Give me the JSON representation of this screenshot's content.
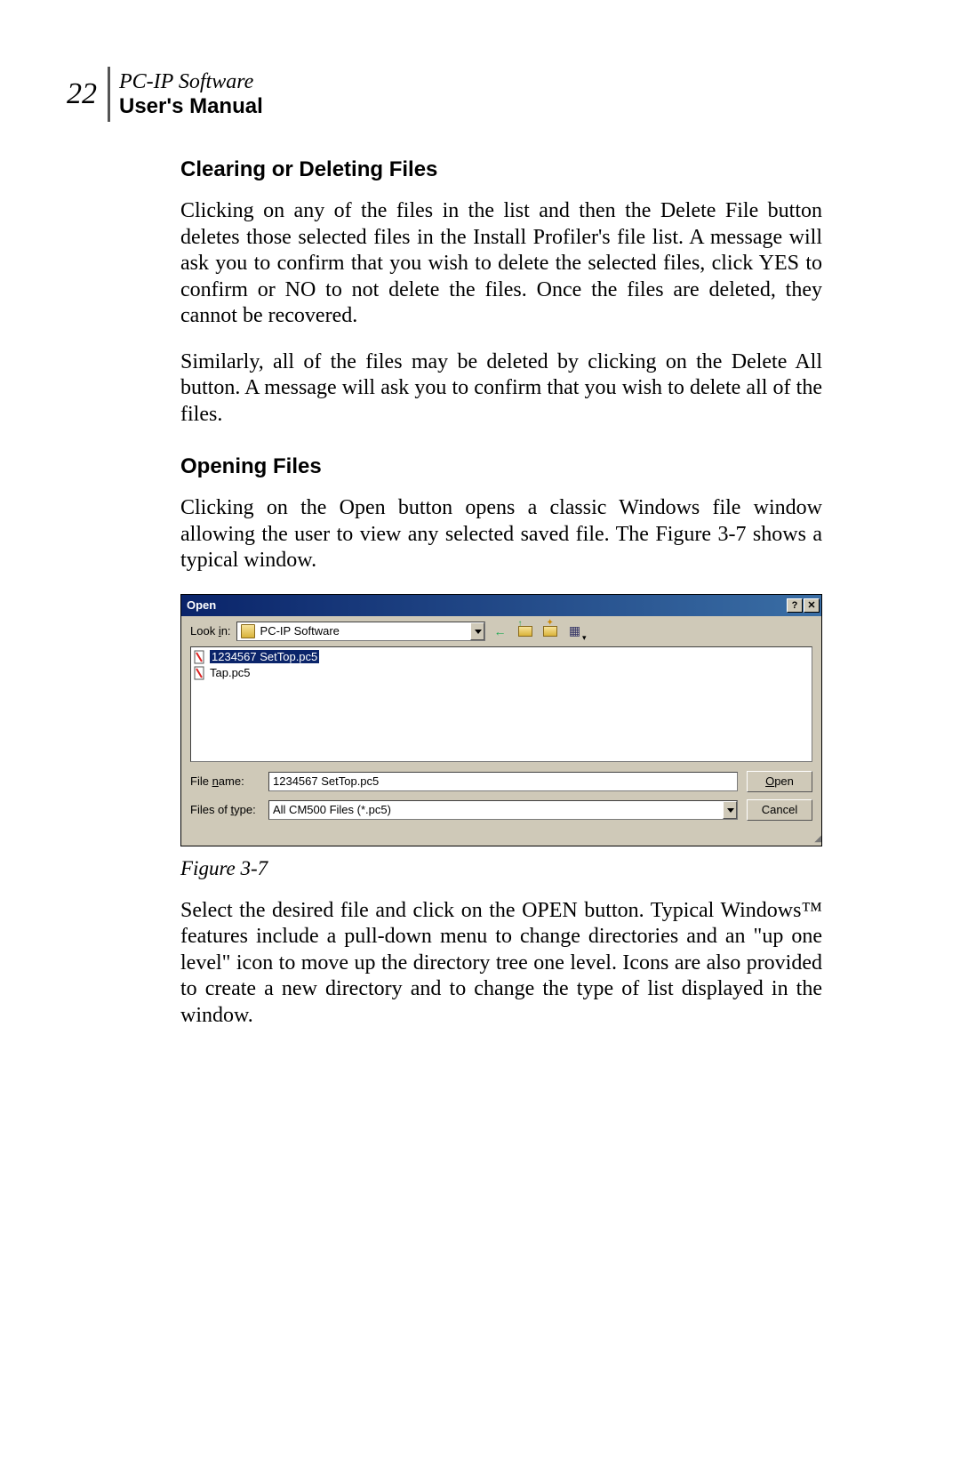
{
  "header": {
    "page_number": "22",
    "title_italic": "PC-IP Software",
    "title_bold": "User's Manual"
  },
  "section1": {
    "heading": "Clearing or Deleting Files",
    "p1": "Clicking on any of the files in the list and then the Delete File button deletes those selected files in the Install Profiler's file list. A message will ask you to confirm that you wish to delete the selected files, click YES to confirm or NO to not delete the files. Once the files are deleted, they cannot be recovered.",
    "p2": "Similarly, all of the files may be deleted by clicking on the Delete All button. A message will ask you to confirm that you wish to delete all of the files."
  },
  "section2": {
    "heading": "Opening Files",
    "p1": "Clicking on the Open button opens a classic Windows file window allowing the user to view any selected saved file. The Figure 3-7 shows a typical window."
  },
  "dialog": {
    "title": "Open",
    "help_btn": "?",
    "close_btn": "✕",
    "lookin_label": "Look in:",
    "lookin_value": "PC-IP Software",
    "files": [
      {
        "name": "1234567 SetTop.pc5",
        "selected": true
      },
      {
        "name": "Tap.pc5",
        "selected": false
      }
    ],
    "filename_label": "File name:",
    "filename_value": "1234567 SetTop.pc5",
    "filetype_label": "Files of type:",
    "filetype_value": "All CM500 Files (*.pc5)",
    "open_btn": "Open",
    "cancel_btn": "Cancel"
  },
  "figure_caption": "Figure 3-7",
  "section3": {
    "p1": "Select the desired file and click on the OPEN button. Typical Windows™ features include a pull-down menu to change directories and an \"up one level\" icon to move up the directory tree one level. Icons are also provided to create a new directory and to change the type of list displayed in the window."
  }
}
